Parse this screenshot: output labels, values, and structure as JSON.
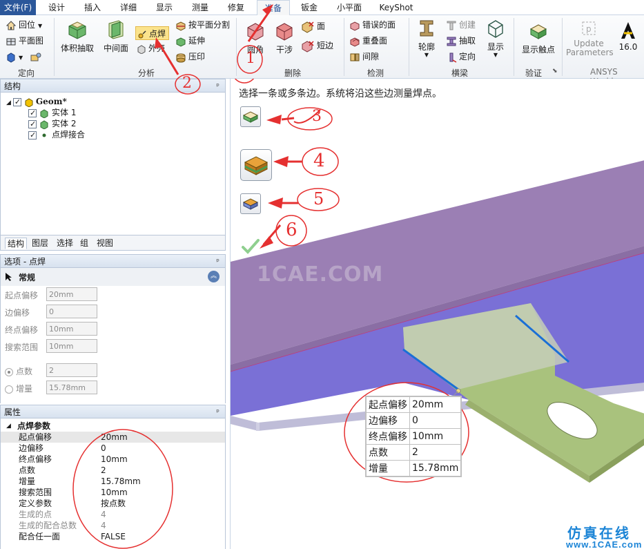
{
  "menu": {
    "file": "文件(F)",
    "tabs": [
      "设计",
      "插入",
      "详细",
      "显示",
      "测量",
      "修复",
      "准备",
      "钣金",
      "小平面",
      "KeyShot"
    ],
    "active_tab": "准备"
  },
  "ribbon": {
    "orient": {
      "label": "定向",
      "items": [
        "回位",
        "平面图"
      ]
    },
    "analysis": {
      "label": "分析",
      "volume_extract": "体积抽取",
      "midsurface": "中间面",
      "spot_weld": "点焊",
      "outer": "外壳",
      "split_by_plane": "按平面分割",
      "extend": "延伸",
      "imprint": "压印"
    },
    "remove": {
      "label": "删除",
      "round": "圆角",
      "interference": "干涉",
      "face": "面",
      "short_edge": "短边"
    },
    "detect": {
      "label": "检测",
      "bad_faces": "错误的面",
      "overlap_faces": "重叠面",
      "gaps": "间隙"
    },
    "beams": {
      "label": "横梁",
      "profile": "轮廓",
      "create": "创建",
      "extract": "抽取",
      "orient": "定向",
      "display": "显示"
    },
    "verify": {
      "label": "验证",
      "show_contacts": "显示触点"
    },
    "update_parameters": "Update Parameters",
    "ansys": {
      "version": "16.0",
      "label": "ANSYS Workbe"
    }
  },
  "structure": {
    "title": "结构",
    "pin": "ᵒ",
    "tree": [
      {
        "label": "Geom*",
        "bold": true
      },
      {
        "label": "实体 1"
      },
      {
        "label": "实体 2"
      },
      {
        "label": "点焊接合"
      }
    ]
  },
  "bottom_tabs": [
    "结构",
    "图层",
    "选择",
    "组",
    "视图"
  ],
  "options": {
    "title": "选项 - 点焊",
    "section": "常规",
    "fields": [
      {
        "label": "起点偏移",
        "value": "20mm"
      },
      {
        "label": "边偏移",
        "value": "0"
      },
      {
        "label": "终点偏移",
        "value": "10mm"
      },
      {
        "label": "搜索范围",
        "value": "10mm"
      }
    ],
    "radios": [
      {
        "label": "点数",
        "value": "2",
        "selected": true
      },
      {
        "label": "增量",
        "value": "15.78mm",
        "selected": false
      }
    ]
  },
  "properties": {
    "title": "属性",
    "section": "点焊参数",
    "rows": [
      {
        "key": "起点偏移",
        "value": "20mm",
        "selected": true
      },
      {
        "key": "边偏移",
        "value": "0"
      },
      {
        "key": "终点偏移",
        "value": "10mm"
      },
      {
        "key": "点数",
        "value": "2"
      },
      {
        "key": "增量",
        "value": "15.78mm"
      },
      {
        "key": "搜索范围",
        "value": "10mm"
      },
      {
        "key": "定义参数",
        "value": "按点数"
      },
      {
        "key": "生成的点",
        "value": "4",
        "dim": true
      },
      {
        "key": "生成的配合总数",
        "value": "4",
        "dim": true
      },
      {
        "key": "配合任一面",
        "value": "FALSE"
      }
    ]
  },
  "viewport": {
    "hint": "选择一条或多条边。系统将沿这些边测量焊点。",
    "watermark": "1CAE.COM",
    "callout": [
      {
        "key": "起点偏移",
        "value": "20mm"
      },
      {
        "key": "边偏移",
        "value": "0"
      },
      {
        "key": "终点偏移",
        "value": "10mm"
      },
      {
        "key": "点数",
        "value": "2"
      },
      {
        "key": "增量",
        "value": "15.78mm"
      }
    ],
    "logo": "仿真在线",
    "logo_url": "www.1CAE.com"
  },
  "annotations": [
    "2",
    "1",
    "3",
    "4",
    "5",
    "6"
  ],
  "colors": {
    "accent": "#2b579a",
    "part_purple": "#9b7fb4",
    "part_blue": "#7a70d6",
    "part_green": "#a9c27d",
    "annotation_red": "#e53030",
    "edge_blue": "#1a6fd6"
  }
}
